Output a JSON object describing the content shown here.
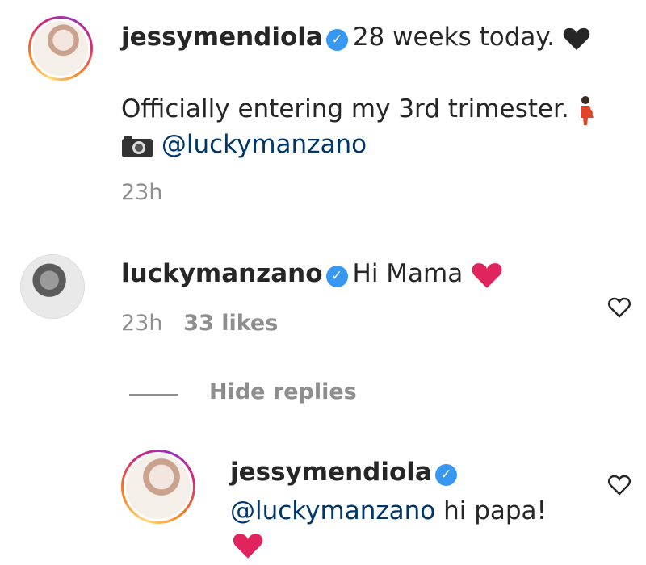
{
  "post": {
    "username": "jessymendiola",
    "caption_line1": "28 weeks today.",
    "caption_line2": "Officially entering my 3rd trimester.",
    "mention": "@luckymanzano",
    "time": "23h"
  },
  "comment": {
    "username": "luckymanzano",
    "text": "Hi Mama",
    "time": "23h",
    "likes": "33 likes"
  },
  "replies_toggle": "Hide replies",
  "reply": {
    "username": "jessymendiola",
    "mention": "@luckymanzano",
    "text": "hi papa!"
  },
  "icons": [
    "verified-badge-icon",
    "black-heart-icon",
    "red-heart-icon",
    "pregnant-woman-icon",
    "camera-icon",
    "heart-outline-icon"
  ],
  "colors": {
    "verified": "#3897f0",
    "mention": "#00376b",
    "meta": "#8e8e8e",
    "heart": "#e0245e"
  }
}
